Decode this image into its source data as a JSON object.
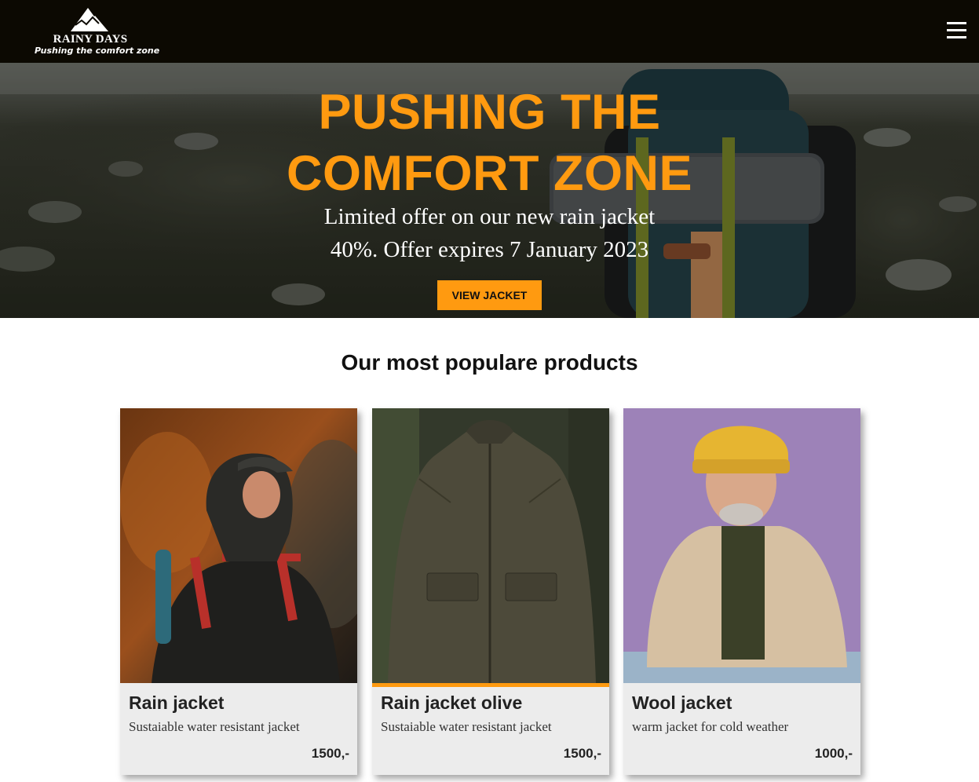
{
  "header": {
    "logo_name": "RAINY DAYS",
    "logo_tagline": "Pushing the comfort zone",
    "logo_icon": "mountain-icon",
    "menu_icon": "hamburger-menu-icon"
  },
  "hero": {
    "title_line1": "PUSHING THE",
    "title_line2": "COMFORT ZONE",
    "offer_line1": "Limited offer on our new rain jacket",
    "offer_line2": "40%. Offer expires 7 January 2023",
    "button_label": "VIEW JACKET"
  },
  "products": {
    "heading": "Our most populare products",
    "items": [
      {
        "name": "Rain jacket",
        "description": "Sustaiable water resistant jacket",
        "price": "1500,-"
      },
      {
        "name": "Rain jacket olive",
        "description": "Sustaiable water resistant jacket",
        "price": "1500,-"
      },
      {
        "name": "Wool jacket",
        "description": "warm jacket for cold weather",
        "price": "1000,-"
      }
    ]
  },
  "colors": {
    "accent": "#ff9a10",
    "header_bg": "#0c0902",
    "card_bg": "#ececec"
  }
}
